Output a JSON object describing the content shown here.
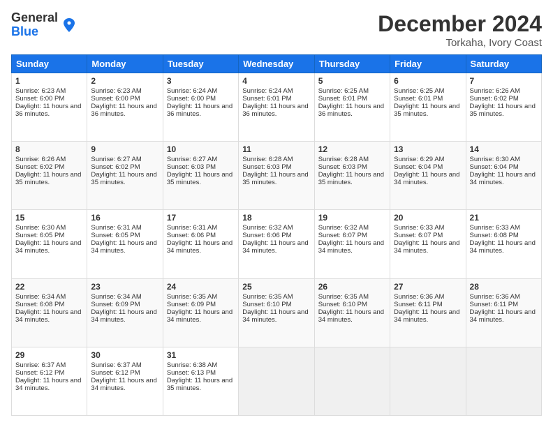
{
  "logo": {
    "general": "General",
    "blue": "Blue"
  },
  "title": "December 2024",
  "subtitle": "Torkaha, Ivory Coast",
  "days_of_week": [
    "Sunday",
    "Monday",
    "Tuesday",
    "Wednesday",
    "Thursday",
    "Friday",
    "Saturday"
  ],
  "weeks": [
    [
      {
        "day": 1,
        "sunrise": "6:23 AM",
        "sunset": "6:00 PM",
        "daylight": "11 hours and 36 minutes."
      },
      {
        "day": 2,
        "sunrise": "6:23 AM",
        "sunset": "6:00 PM",
        "daylight": "11 hours and 36 minutes."
      },
      {
        "day": 3,
        "sunrise": "6:24 AM",
        "sunset": "6:00 PM",
        "daylight": "11 hours and 36 minutes."
      },
      {
        "day": 4,
        "sunrise": "6:24 AM",
        "sunset": "6:01 PM",
        "daylight": "11 hours and 36 minutes."
      },
      {
        "day": 5,
        "sunrise": "6:25 AM",
        "sunset": "6:01 PM",
        "daylight": "11 hours and 36 minutes."
      },
      {
        "day": 6,
        "sunrise": "6:25 AM",
        "sunset": "6:01 PM",
        "daylight": "11 hours and 35 minutes."
      },
      {
        "day": 7,
        "sunrise": "6:26 AM",
        "sunset": "6:02 PM",
        "daylight": "11 hours and 35 minutes."
      }
    ],
    [
      {
        "day": 8,
        "sunrise": "6:26 AM",
        "sunset": "6:02 PM",
        "daylight": "11 hours and 35 minutes."
      },
      {
        "day": 9,
        "sunrise": "6:27 AM",
        "sunset": "6:02 PM",
        "daylight": "11 hours and 35 minutes."
      },
      {
        "day": 10,
        "sunrise": "6:27 AM",
        "sunset": "6:03 PM",
        "daylight": "11 hours and 35 minutes."
      },
      {
        "day": 11,
        "sunrise": "6:28 AM",
        "sunset": "6:03 PM",
        "daylight": "11 hours and 35 minutes."
      },
      {
        "day": 12,
        "sunrise": "6:28 AM",
        "sunset": "6:03 PM",
        "daylight": "11 hours and 35 minutes."
      },
      {
        "day": 13,
        "sunrise": "6:29 AM",
        "sunset": "6:04 PM",
        "daylight": "11 hours and 34 minutes."
      },
      {
        "day": 14,
        "sunrise": "6:30 AM",
        "sunset": "6:04 PM",
        "daylight": "11 hours and 34 minutes."
      }
    ],
    [
      {
        "day": 15,
        "sunrise": "6:30 AM",
        "sunset": "6:05 PM",
        "daylight": "11 hours and 34 minutes."
      },
      {
        "day": 16,
        "sunrise": "6:31 AM",
        "sunset": "6:05 PM",
        "daylight": "11 hours and 34 minutes."
      },
      {
        "day": 17,
        "sunrise": "6:31 AM",
        "sunset": "6:06 PM",
        "daylight": "11 hours and 34 minutes."
      },
      {
        "day": 18,
        "sunrise": "6:32 AM",
        "sunset": "6:06 PM",
        "daylight": "11 hours and 34 minutes."
      },
      {
        "day": 19,
        "sunrise": "6:32 AM",
        "sunset": "6:07 PM",
        "daylight": "11 hours and 34 minutes."
      },
      {
        "day": 20,
        "sunrise": "6:33 AM",
        "sunset": "6:07 PM",
        "daylight": "11 hours and 34 minutes."
      },
      {
        "day": 21,
        "sunrise": "6:33 AM",
        "sunset": "6:08 PM",
        "daylight": "11 hours and 34 minutes."
      }
    ],
    [
      {
        "day": 22,
        "sunrise": "6:34 AM",
        "sunset": "6:08 PM",
        "daylight": "11 hours and 34 minutes."
      },
      {
        "day": 23,
        "sunrise": "6:34 AM",
        "sunset": "6:09 PM",
        "daylight": "11 hours and 34 minutes."
      },
      {
        "day": 24,
        "sunrise": "6:35 AM",
        "sunset": "6:09 PM",
        "daylight": "11 hours and 34 minutes."
      },
      {
        "day": 25,
        "sunrise": "6:35 AM",
        "sunset": "6:10 PM",
        "daylight": "11 hours and 34 minutes."
      },
      {
        "day": 26,
        "sunrise": "6:35 AM",
        "sunset": "6:10 PM",
        "daylight": "11 hours and 34 minutes."
      },
      {
        "day": 27,
        "sunrise": "6:36 AM",
        "sunset": "6:11 PM",
        "daylight": "11 hours and 34 minutes."
      },
      {
        "day": 28,
        "sunrise": "6:36 AM",
        "sunset": "6:11 PM",
        "daylight": "11 hours and 34 minutes."
      }
    ],
    [
      {
        "day": 29,
        "sunrise": "6:37 AM",
        "sunset": "6:12 PM",
        "daylight": "11 hours and 34 minutes."
      },
      {
        "day": 30,
        "sunrise": "6:37 AM",
        "sunset": "6:12 PM",
        "daylight": "11 hours and 34 minutes."
      },
      {
        "day": 31,
        "sunrise": "6:38 AM",
        "sunset": "6:13 PM",
        "daylight": "11 hours and 35 minutes."
      },
      null,
      null,
      null,
      null
    ]
  ]
}
